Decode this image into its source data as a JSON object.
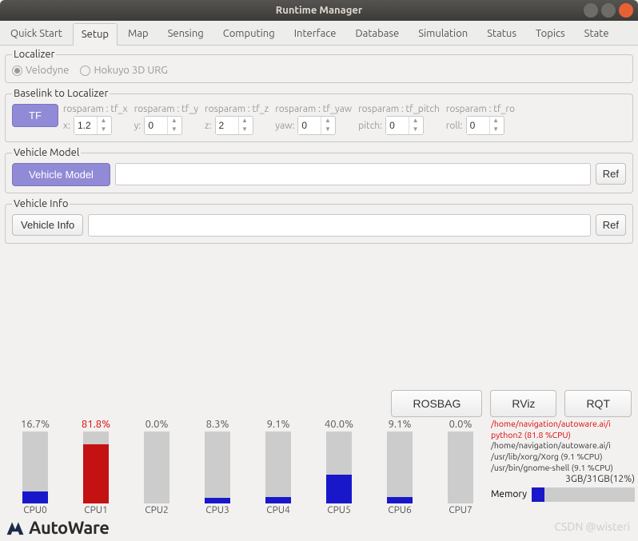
{
  "window": {
    "title": "Runtime Manager"
  },
  "tabs": [
    "Quick Start",
    "Setup",
    "Map",
    "Sensing",
    "Computing",
    "Interface",
    "Database",
    "Simulation",
    "Status",
    "Topics",
    "State"
  ],
  "active_tab": "Setup",
  "localizer": {
    "legend": "Localizer",
    "options": [
      {
        "label": "Velodyne",
        "checked": true
      },
      {
        "label": "Hokuyo 3D URG",
        "checked": false
      }
    ]
  },
  "baselink": {
    "legend": "Baselink to Localizer",
    "tf_button": "TF",
    "fields": [
      {
        "label": "rosparam : tf_x",
        "prefix": "x:",
        "value": "1.2"
      },
      {
        "label": "rosparam : tf_y",
        "prefix": "y:",
        "value": "0"
      },
      {
        "label": "rosparam : tf_z",
        "prefix": "z:",
        "value": "2"
      },
      {
        "label": "rosparam : tf_yaw",
        "prefix": "yaw:",
        "value": "0"
      },
      {
        "label": "rosparam : tf_pitch",
        "prefix": "pitch:",
        "value": "0"
      },
      {
        "label": "rosparam : tf_ro",
        "prefix": "roll:",
        "value": "0"
      }
    ]
  },
  "vehicle_model": {
    "legend": "Vehicle Model",
    "button": "Vehicle Model",
    "ref": "Ref"
  },
  "vehicle_info": {
    "legend": "Vehicle Info",
    "button": "Vehicle Info",
    "ref": "Ref"
  },
  "bottom_buttons": {
    "rosbag": "ROSBAG",
    "rviz": "RViz",
    "rqt": "RQT"
  },
  "cpus": [
    {
      "name": "CPU0",
      "pct": "16.7%",
      "value": 16.7,
      "hot": false
    },
    {
      "name": "CPU1",
      "pct": "81.8%",
      "value": 81.8,
      "hot": true
    },
    {
      "name": "CPU2",
      "pct": "0.0%",
      "value": 0.0,
      "hot": false
    },
    {
      "name": "CPU3",
      "pct": "8.3%",
      "value": 8.3,
      "hot": false
    },
    {
      "name": "CPU4",
      "pct": "9.1%",
      "value": 9.1,
      "hot": false
    },
    {
      "name": "CPU5",
      "pct": "40.0%",
      "value": 40.0,
      "hot": false
    },
    {
      "name": "CPU6",
      "pct": "9.1%",
      "value": 9.1,
      "hot": false
    },
    {
      "name": "CPU7",
      "pct": "0.0%",
      "value": 0.0,
      "hot": false
    }
  ],
  "processes": [
    {
      "text": "/home/navigation/autoware.ai/i",
      "hot": true
    },
    {
      "text": "python2 (81.8 %CPU)",
      "hot": true
    },
    {
      "text": "/home/navigation/autoware.ai/i",
      "hot": false
    },
    {
      "text": "/usr/lib/xorg/Xorg (9.1 %CPU)",
      "hot": false
    },
    {
      "text": "/usr/bin/gnome-shell (9.1 %CPU)",
      "hot": false
    }
  ],
  "memory": {
    "summary": "3GB/31GB(12%)",
    "label": "Memory",
    "value": 12
  },
  "footer": {
    "brand": "AutoWare"
  },
  "watermark": "CSDN @wisteri"
}
